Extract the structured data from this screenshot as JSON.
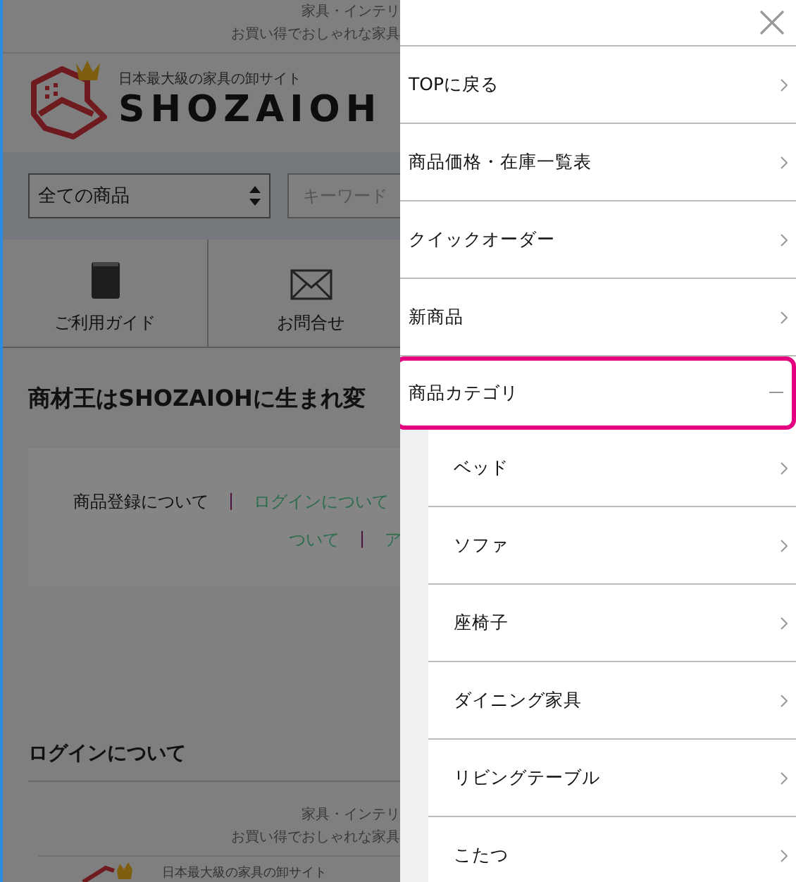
{
  "page": {
    "tagline": [
      "家具・インテリ",
      "お買い得でおしゃれな家具"
    ],
    "logo": {
      "subtitle": "日本最大級の家具の卸サイト",
      "name": "SHOZAIOH"
    },
    "search": {
      "category": "全ての商品",
      "placeholder": "キーワード"
    },
    "nav": [
      {
        "label": "ご利用ガイド",
        "kind": "book"
      },
      {
        "label": "お問合せ",
        "kind": "mail"
      }
    ],
    "heading": "商材王はSHOZAIOHに生まれ変",
    "notice_lines": [
      [
        {
          "kind": "text",
          "text": "商品登録について"
        },
        {
          "kind": "sep",
          "text": "|"
        },
        {
          "kind": "link",
          "text": "ログインについて"
        }
      ],
      [
        {
          "kind": "link",
          "text": "ついて"
        },
        {
          "kind": "sep",
          "text": "|"
        },
        {
          "kind": "link",
          "text": "ア"
        }
      ]
    ],
    "section_title": "ログインについて",
    "footer_tagline": [
      "家具・インテリ",
      "お買い得でおしゃれな家具"
    ],
    "footer_logo_subtitle": "日本最大級の家具の卸サイト"
  },
  "menu": {
    "items": [
      {
        "label": "TOPに戻る",
        "expanded": false,
        "highlighted": false
      },
      {
        "label": "商品価格・在庫一覧表",
        "expanded": false,
        "highlighted": false
      },
      {
        "label": "クイックオーダー",
        "expanded": false,
        "highlighted": false
      },
      {
        "label": "新商品",
        "expanded": false,
        "highlighted": false
      },
      {
        "label": "商品カテゴリ",
        "expanded": true,
        "highlighted": true,
        "children": [
          {
            "label": "ベッド"
          },
          {
            "label": "ソファ"
          },
          {
            "label": "座椅子"
          },
          {
            "label": "ダイニング家具"
          },
          {
            "label": "リビングテーブル"
          },
          {
            "label": "こたつ"
          }
        ]
      }
    ]
  }
}
